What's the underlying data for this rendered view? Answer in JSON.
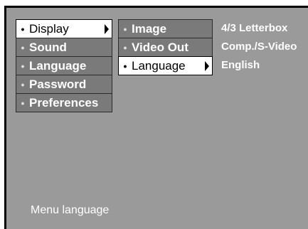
{
  "main_menu": {
    "items": [
      {
        "label": "Display"
      },
      {
        "label": "Sound"
      },
      {
        "label": "Language"
      },
      {
        "label": "Password"
      },
      {
        "label": "Preferences"
      }
    ],
    "selected": "Display"
  },
  "sub_menu": {
    "items": [
      {
        "label": "Image"
      },
      {
        "label": "Video Out"
      },
      {
        "label": "Language"
      }
    ],
    "selected": "Language"
  },
  "values": [
    "4/3 Letterbox",
    "Comp./S-Video",
    "English"
  ],
  "status_text": "Menu language",
  "colors": {
    "background": "#9a9a9a",
    "item": "#7a7a7a",
    "selected": "#ffffff",
    "text": "#ffffff"
  }
}
